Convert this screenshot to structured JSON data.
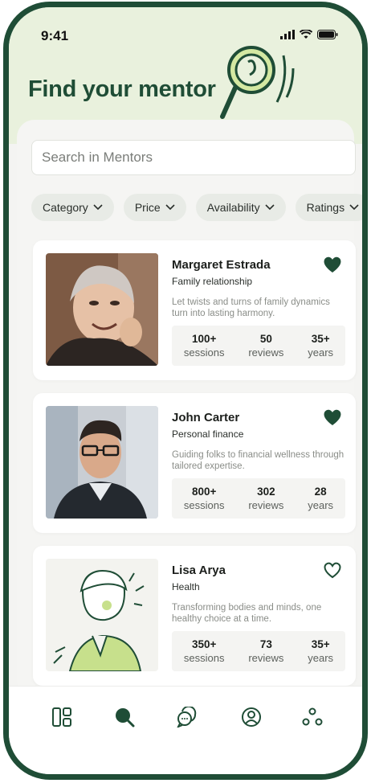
{
  "status_bar": {
    "time": "9:41"
  },
  "header": {
    "title": "Find your mentor"
  },
  "search": {
    "placeholder": "Search in Mentors"
  },
  "filters": [
    {
      "label": "Category"
    },
    {
      "label": "Price"
    },
    {
      "label": "Availability"
    },
    {
      "label": "Ratings"
    }
  ],
  "mentors": [
    {
      "name": "Margaret Estrada",
      "specialty": "Family relationship",
      "tagline": "Let twists and turns of family dynamics turn into lasting harmony.",
      "favorited": true,
      "stats": [
        {
          "value": "100+",
          "label": "sessions"
        },
        {
          "value": "50",
          "label": "reviews"
        },
        {
          "value": "35+",
          "label": "years"
        }
      ]
    },
    {
      "name": "John Carter",
      "specialty": "Personal finance",
      "tagline": "Guiding folks to financial wellness through tailored expertise.",
      "favorited": true,
      "stats": [
        {
          "value": "800+",
          "label": "sessions"
        },
        {
          "value": "302",
          "label": "reviews"
        },
        {
          "value": "28",
          "label": "years"
        }
      ]
    },
    {
      "name": "Lisa Arya",
      "specialty": "Health",
      "tagline": "Transforming bodies and minds, one healthy choice at a time.",
      "favorited": false,
      "stats": [
        {
          "value": "350+",
          "label": "sessions"
        },
        {
          "value": "73",
          "label": "reviews"
        },
        {
          "value": "35+",
          "label": "years"
        }
      ]
    }
  ],
  "bottom_nav": [
    {
      "icon": "dashboard-icon",
      "active": false
    },
    {
      "icon": "search-icon",
      "active": true
    },
    {
      "icon": "chat-icon",
      "active": false
    },
    {
      "icon": "profile-icon",
      "active": false
    },
    {
      "icon": "community-icon",
      "active": false
    }
  ],
  "colors": {
    "brand_green": "#1f4d36",
    "hero_bg": "#e9f1dd",
    "accent_lime": "#c7e08c"
  }
}
